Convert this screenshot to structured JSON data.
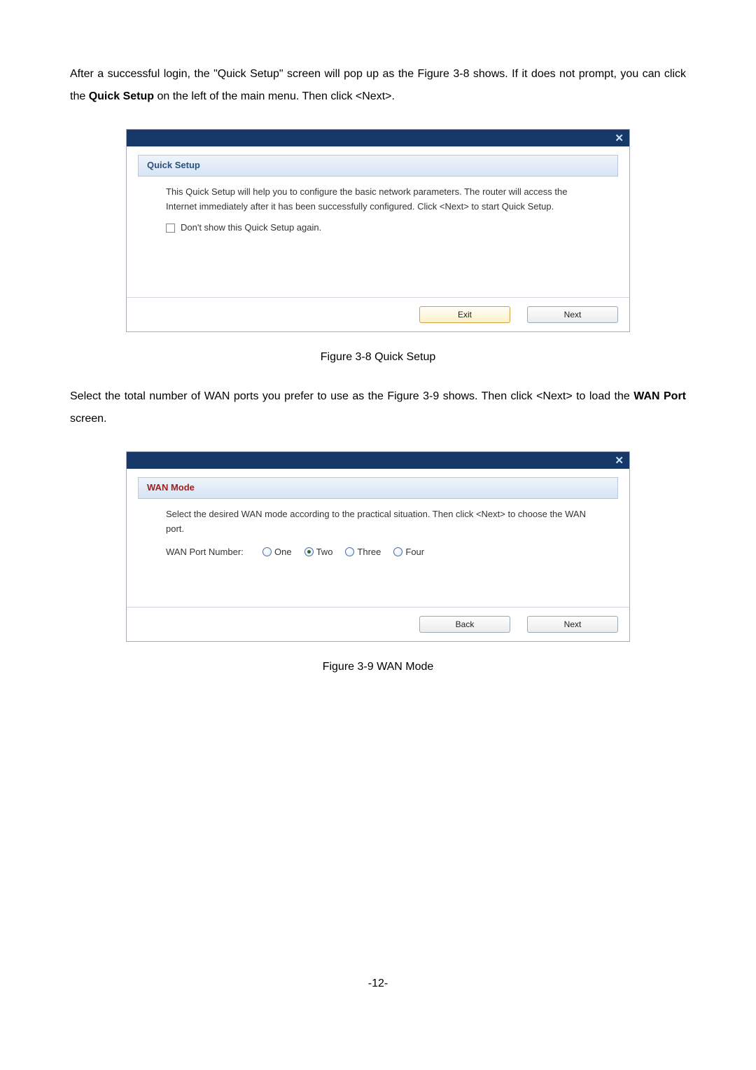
{
  "intro_para_pre": "After a successful login, the \"Quick Setup\" screen will pop up as the Figure 3-8 shows. If it does not prompt, you can click the ",
  "intro_para_bold": "Quick Setup",
  "intro_para_post": " on the left of the main menu. Then click <Next>.",
  "dialog1": {
    "close_glyph": "✕",
    "header": "Quick Setup",
    "body_text": "This Quick Setup will help you to configure the basic network parameters. The router will access the Internet immediately after it has been successfully configured. Click <Next> to start Quick Setup.",
    "checkbox_label": "Don't show this Quick Setup again.",
    "btn_left": "Exit",
    "btn_right": "Next"
  },
  "figure1_caption": "Figure 3-8    Quick Setup",
  "mid_para_pre": "Select the total number of WAN ports you prefer to use as the Figure 3-9 shows. Then click <Next> to load the ",
  "mid_para_bold": "WAN Port",
  "mid_para_post": " screen.",
  "dialog2": {
    "close_glyph": "✕",
    "header": "WAN Mode",
    "body_text": "Select the desired WAN mode according to the practical situation. Then click <Next> to choose the WAN port.",
    "row_label": "WAN Port Number:",
    "options": {
      "one": "One",
      "two": "Two",
      "three": "Three",
      "four": "Four"
    },
    "btn_left": "Back",
    "btn_right": "Next"
  },
  "figure2_caption": "Figure 3-9    WAN Mode",
  "page_number": "-12-"
}
